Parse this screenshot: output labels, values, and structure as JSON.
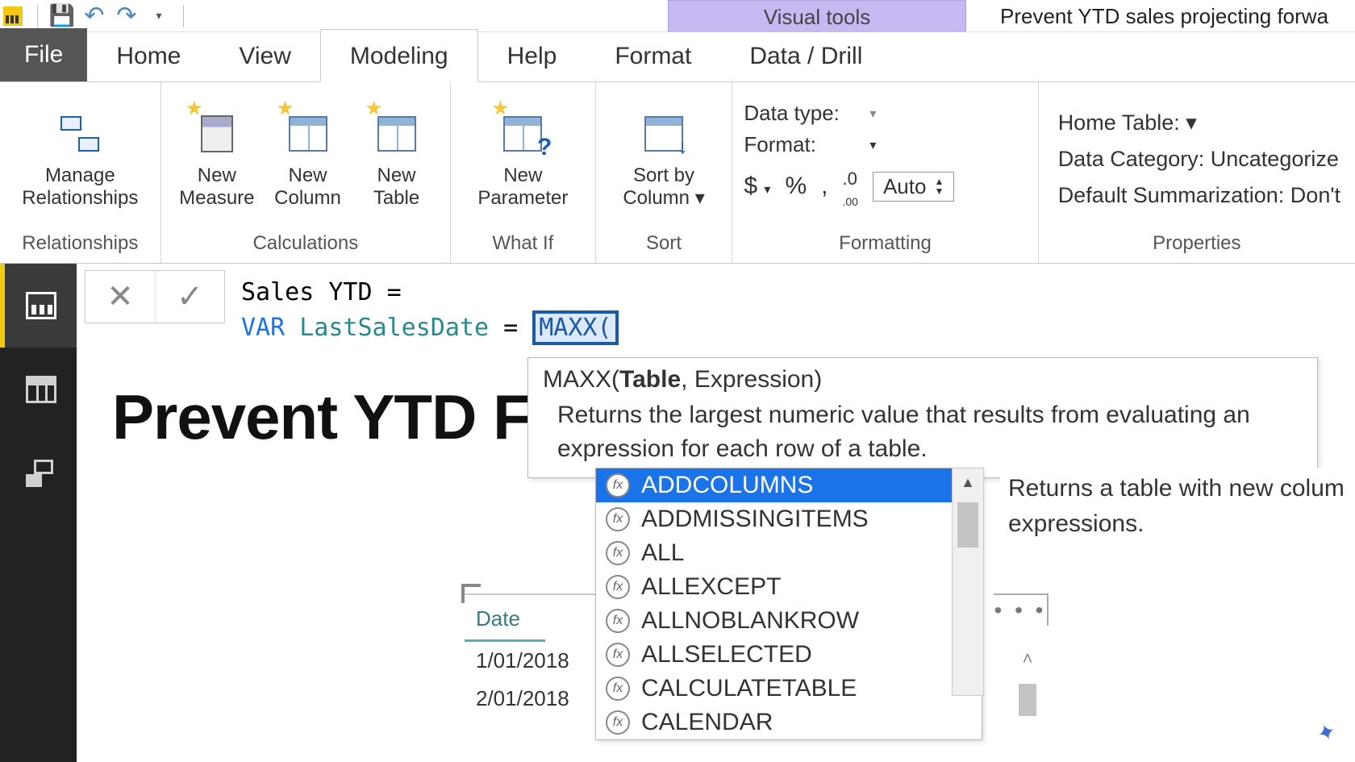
{
  "qat": {
    "save": "💾",
    "undo": "↶",
    "redo": "↷",
    "dd": "▾"
  },
  "title_bar": {
    "visual_tools": "Visual tools",
    "filename": "Prevent YTD sales projecting forwa"
  },
  "tabs": {
    "file": "File",
    "home": "Home",
    "view": "View",
    "modeling": "Modeling",
    "help": "Help",
    "format": "Format",
    "datadrill": "Data / Drill"
  },
  "ribbon": {
    "relationships": {
      "manage": "Manage\nRelationships",
      "label": "Relationships"
    },
    "calculations": {
      "measure": "New\nMeasure",
      "column": "New\nColumn",
      "table": "New\nTable",
      "label": "Calculations"
    },
    "whatif": {
      "param": "New\nParameter",
      "label": "What If"
    },
    "sort": {
      "sortby": "Sort by\nColumn",
      "label": "Sort",
      "caret": "▾"
    },
    "formatting": {
      "datatype_lbl": "Data type:",
      "format_lbl": "Format:",
      "currency": "$",
      "percent": "%",
      "comma": ",",
      "decimals": ".00",
      "auto": "Auto",
      "label": "Formatting"
    },
    "properties": {
      "home_table": "Home Table:",
      "data_category": "Data Category: Uncategorize",
      "default_sum": "Default Summarization: Don't",
      "label": "Properties"
    }
  },
  "formula": {
    "line1_a": "Sales YTD ",
    "line1_b": "=",
    "var": "VAR",
    "ident": "LastSalesDate",
    "eq": "=",
    "fn": "MAXX(",
    "cancel": "✕",
    "accept": "✓"
  },
  "tooltip": {
    "sig_fn": "MAXX(",
    "sig_p1": "Table",
    "sig_rest": ", Expression)",
    "desc": "Returns the largest numeric value that results from evaluating an expression for each row of a table."
  },
  "autocomplete": {
    "items": [
      "ADDCOLUMNS",
      "ADDMISSINGITEMS",
      "ALL",
      "ALLEXCEPT",
      "ALLNOBLANKROW",
      "ALLSELECTED",
      "CALCULATETABLE",
      "CALENDAR"
    ],
    "selected_index": 0,
    "side_desc": "Returns a table with new colum expressions."
  },
  "canvas": {
    "heading": "Prevent YTD F"
  },
  "mini_table": {
    "header": "Date",
    "rows": [
      "1/01/2018",
      "2/01/2018"
    ]
  },
  "ellipsis": "• • •"
}
